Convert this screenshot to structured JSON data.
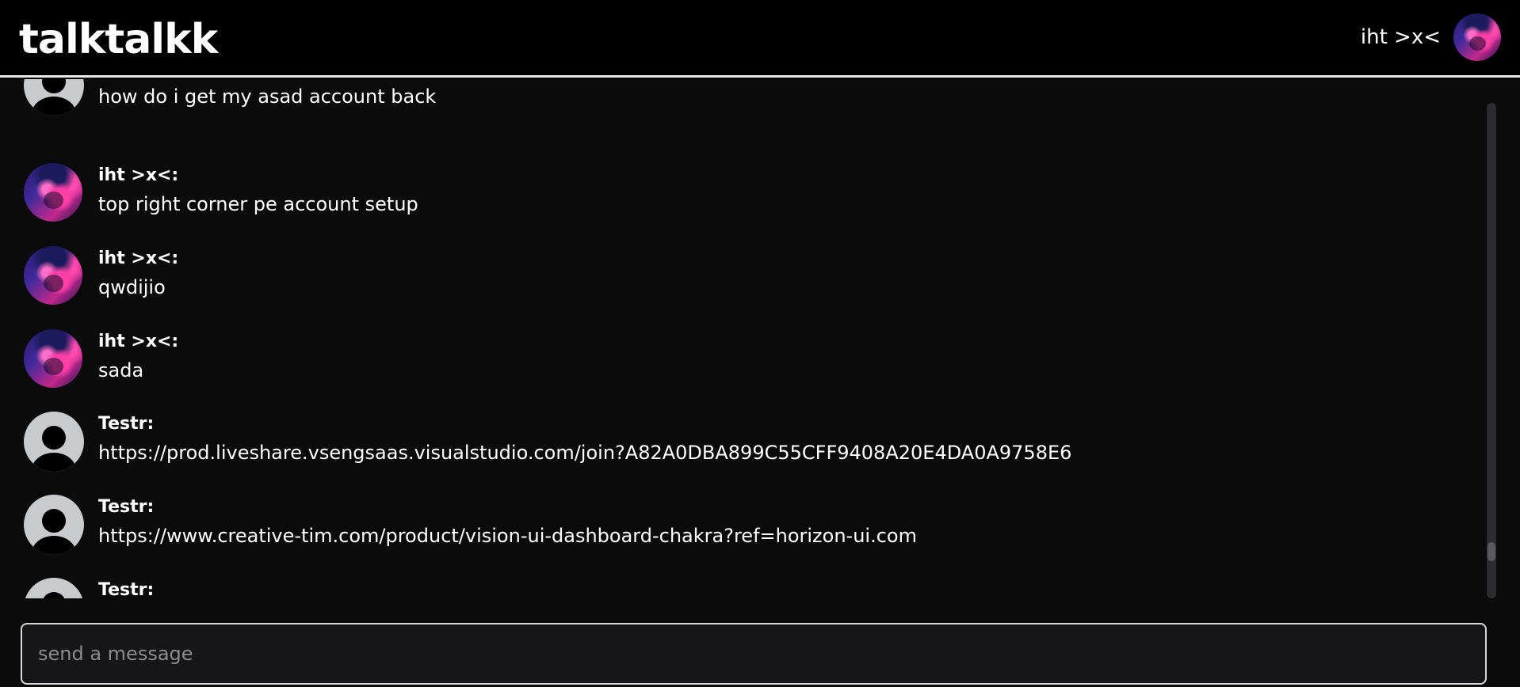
{
  "header": {
    "app_title": "talktalkk",
    "user_name": "iht >x<"
  },
  "messages": [
    {
      "author": "",
      "avatar": "default-avatar-icon",
      "text": "how do i get my asad account back"
    },
    {
      "author": "iht >x<:",
      "avatar": "user-avatar",
      "text": "top right corner pe account setup"
    },
    {
      "author": "iht >x<:",
      "avatar": "user-avatar",
      "text": "qwdijio"
    },
    {
      "author": "iht >x<:",
      "avatar": "user-avatar",
      "text": "sada"
    },
    {
      "author": "Testr:",
      "avatar": "default-avatar-icon",
      "text": "https://prod.liveshare.vsengsaas.visualstudio.com/join?A82A0DBA899C55CFF9408A20E4DA0A9758E6"
    },
    {
      "author": "Testr:",
      "avatar": "default-avatar-icon",
      "text": "https://www.creative-tim.com/product/vision-ui-dashboard-chakra?ref=horizon-ui.com"
    },
    {
      "author": "Testr:",
      "avatar": "default-avatar-icon",
      "text": ""
    }
  ],
  "composer": {
    "placeholder": "send a message",
    "value": ""
  },
  "colors": {
    "background": "#0b0b0c",
    "header_bg": "#000000",
    "accent_pink": "#ff3fa8",
    "default_avatar_bg": "#c8cacc"
  }
}
